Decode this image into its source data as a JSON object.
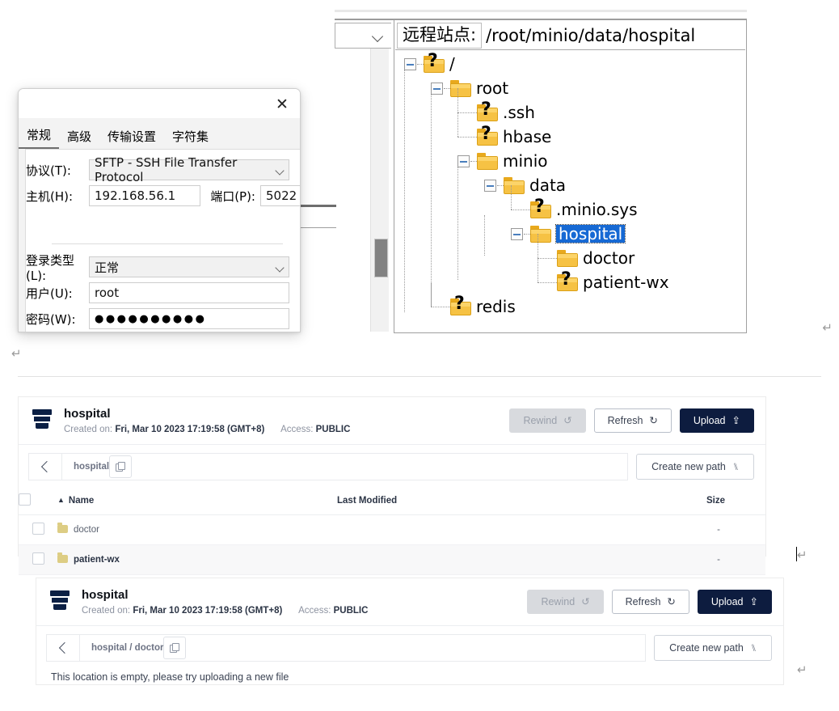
{
  "document": {
    "pilcrow_glyph": "↵"
  },
  "filezilla": {
    "remote_site_label": "远程站点:",
    "remote_site_path": "/root/minio/data/hospital",
    "tree": [
      {
        "label": "/",
        "depth": 0,
        "icon": "folder-unknown-icon",
        "expander": "collapse",
        "selected": false
      },
      {
        "label": "root",
        "depth": 1,
        "icon": "folder-icon",
        "expander": "collapse",
        "selected": false
      },
      {
        "label": ".ssh",
        "depth": 2,
        "icon": "folder-unknown-icon",
        "expander": "none",
        "selected": false
      },
      {
        "label": "hbase",
        "depth": 2,
        "icon": "folder-unknown-icon",
        "expander": "none",
        "selected": false
      },
      {
        "label": "minio",
        "depth": 2,
        "icon": "folder-icon",
        "expander": "collapse",
        "selected": false
      },
      {
        "label": "data",
        "depth": 3,
        "icon": "folder-icon",
        "expander": "collapse",
        "selected": false
      },
      {
        "label": ".minio.sys",
        "depth": 4,
        "icon": "folder-unknown-icon",
        "expander": "none",
        "selected": false
      },
      {
        "label": "hospital",
        "depth": 4,
        "icon": "folder-icon",
        "expander": "collapse",
        "selected": true
      },
      {
        "label": "doctor",
        "depth": 5,
        "icon": "folder-icon",
        "expander": "none",
        "selected": false
      },
      {
        "label": "patient-wx",
        "depth": 5,
        "icon": "folder-unknown-icon",
        "expander": "none",
        "selected": false
      },
      {
        "label": "redis",
        "depth": 1,
        "icon": "folder-unknown-icon",
        "expander": "none",
        "selected": false
      }
    ]
  },
  "site_manager": {
    "close_label": "✕",
    "tabs": [
      {
        "label": "常规",
        "active": true
      },
      {
        "label": "高级",
        "active": false
      },
      {
        "label": "传输设置",
        "active": false
      },
      {
        "label": "字符集",
        "active": false
      }
    ],
    "fields": {
      "protocol_label": "协议(T):",
      "protocol_value": "SFTP - SSH File Transfer Protocol",
      "host_label": "主机(H):",
      "host_value": "192.168.56.1",
      "port_label": "端口(P):",
      "port_value": "5022",
      "logon_label": "登录类型(L):",
      "logon_value": "正常",
      "user_label": "用户(U):",
      "user_value": "root",
      "password_label": "密码(W):",
      "password_value": "●●●●●●●●●●"
    }
  },
  "minio_panels": [
    {
      "bucket_name": "hospital",
      "created_label": "Created on:",
      "created_value": "Fri, Mar 10 2023 17:19:58 (GMT+8)",
      "access_label": "Access:",
      "access_value": "PUBLIC",
      "buttons": {
        "rewind": "Rewind",
        "refresh": "Refresh",
        "upload": "Upload"
      },
      "breadcrumb": "hospital",
      "create_path_label": "Create new path",
      "table": {
        "columns": [
          "Name",
          "Last Modified",
          "Size"
        ],
        "rows": [
          {
            "name": "doctor",
            "modified": "",
            "size": "-",
            "highlight": false
          },
          {
            "name": "patient-wx",
            "modified": "",
            "size": "-",
            "highlight": true
          }
        ]
      },
      "empty_message": ""
    },
    {
      "bucket_name": "hospital",
      "created_label": "Created on:",
      "created_value": "Fri, Mar 10 2023 17:19:58 (GMT+8)",
      "access_label": "Access:",
      "access_value": "PUBLIC",
      "buttons": {
        "rewind": "Rewind",
        "refresh": "Refresh",
        "upload": "Upload"
      },
      "breadcrumb": "hospital / doctor",
      "create_path_label": "Create new path",
      "table": null,
      "empty_message": "This location is empty, please try uploading a new file"
    }
  ],
  "colors": {
    "navy": "#0d1c3f",
    "folder_yellow": "#f6c244",
    "selection_blue": "#1669d4",
    "folder_khaki": "#ddcd84"
  }
}
